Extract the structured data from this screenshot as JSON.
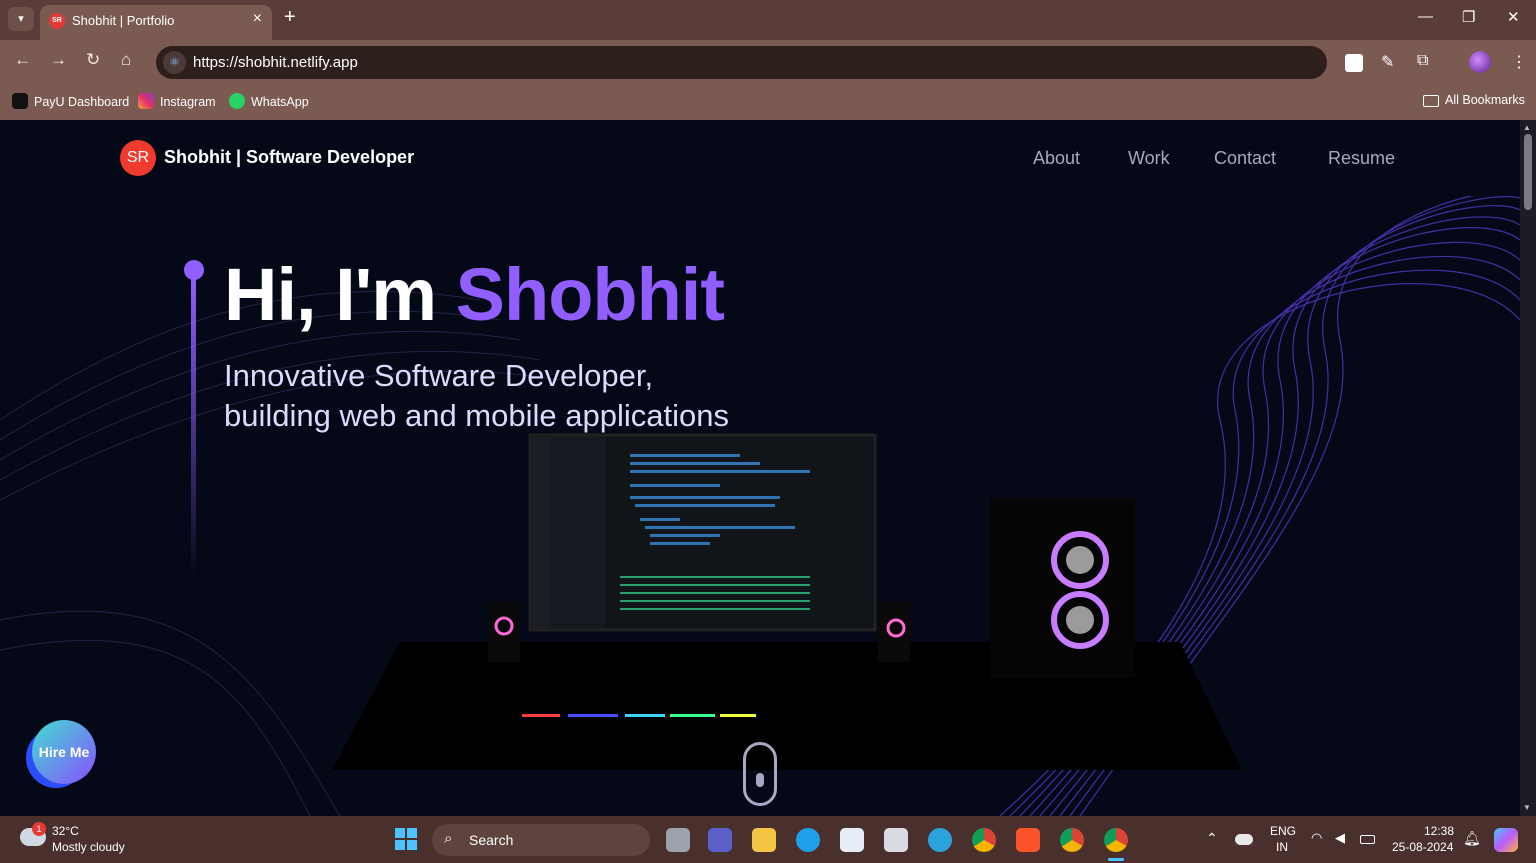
{
  "browser": {
    "tab_title": "Shobhit | Portfolio",
    "tab_favicon": "SR",
    "url": "https://shobhit.netlify.app",
    "bookmarks": [
      {
        "label": "PayU Dashboard",
        "icon": "payu-icon",
        "color": "#111111"
      },
      {
        "label": "Instagram",
        "icon": "instagram-icon",
        "color": "#e1306c"
      },
      {
        "label": "WhatsApp",
        "icon": "whatsapp-icon",
        "color": "#25d366"
      }
    ],
    "all_bookmarks": "All Bookmarks"
  },
  "page": {
    "logo": "SR",
    "brand": "Shobhit | Software Developer",
    "nav": [
      "About",
      "Work",
      "Contact",
      "Resume"
    ],
    "hero": {
      "title_prefix": "Hi, I'm ",
      "title_name": "Shobhit",
      "subtitle_line1": "Innovative Software Developer,",
      "subtitle_line2": "building web and mobile applications"
    },
    "hire_button": "Hire Me",
    "colors": {
      "accent": "#915eff",
      "background": "#050816",
      "nav_text": "#aaa6c3"
    }
  },
  "taskbar": {
    "weather_badge": "1",
    "temperature": "32°C",
    "weather": "Mostly cloudy",
    "search_placeholder": "Search",
    "lang_top": "ENG",
    "lang_bottom": "IN",
    "time": "12:38",
    "date": "25-08-2024"
  }
}
